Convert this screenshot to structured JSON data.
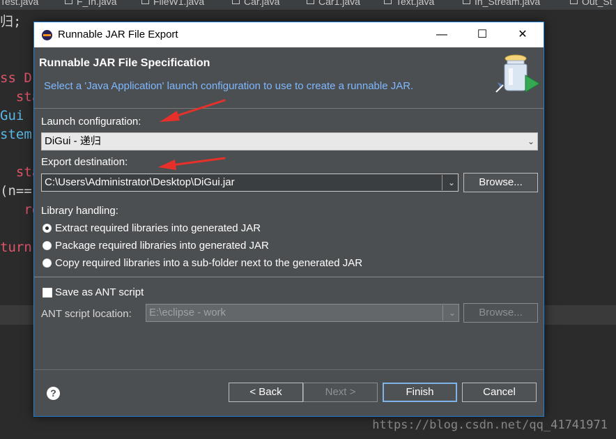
{
  "ide": {
    "tabs": [
      "Test.java",
      "F_In.java",
      "FileW1.java",
      "Car.java",
      "Car1.java",
      "Text.java",
      "In_Stream.java",
      "Out_St"
    ],
    "code_lines": [
      "归;",
      "ss D",
      "  sta",
      "Gui",
      "stem",
      "  sta",
      "(n==",
      "   re",
      "turn"
    ]
  },
  "watermark": "https://blog.csdn.net/qq_41741971",
  "dialog": {
    "window_title": "Runnable JAR File Export",
    "window_controls": {
      "minimize": "—",
      "maximize": "☐",
      "close": "✕"
    },
    "banner_title": "Runnable JAR File Specification",
    "banner_description": "Select a 'Java Application' launch configuration to use to create a runnable JAR.",
    "launch_config": {
      "label": "Launch configuration:",
      "value": "DiGui - 递归"
    },
    "export_destination": {
      "label": "Export destination:",
      "value": "C:\\Users\\Administrator\\Desktop\\DiGui.jar",
      "browse_label": "Browse..."
    },
    "library_handling": {
      "label": "Library handling:",
      "options": [
        {
          "label": "Extract required libraries into generated JAR",
          "selected": true
        },
        {
          "label": "Package required libraries into generated JAR",
          "selected": false
        },
        {
          "label": "Copy required libraries into a sub-folder next to the generated JAR",
          "selected": false
        }
      ]
    },
    "ant": {
      "save_label": "Save as ANT script",
      "save_checked": false,
      "location_label": "ANT script location:",
      "location_value": "E:\\eclipse - work",
      "browse_label": "Browse..."
    },
    "help_label": "?",
    "buttons": {
      "back": "< Back",
      "next": "Next >",
      "finish": "Finish",
      "cancel": "Cancel"
    }
  },
  "colors": {
    "annotation_arrow": "#e8302a",
    "dialog_bg": "#4c4f51",
    "link_blue": "#7fb8ff",
    "focus_border": "#1f7fd6"
  }
}
